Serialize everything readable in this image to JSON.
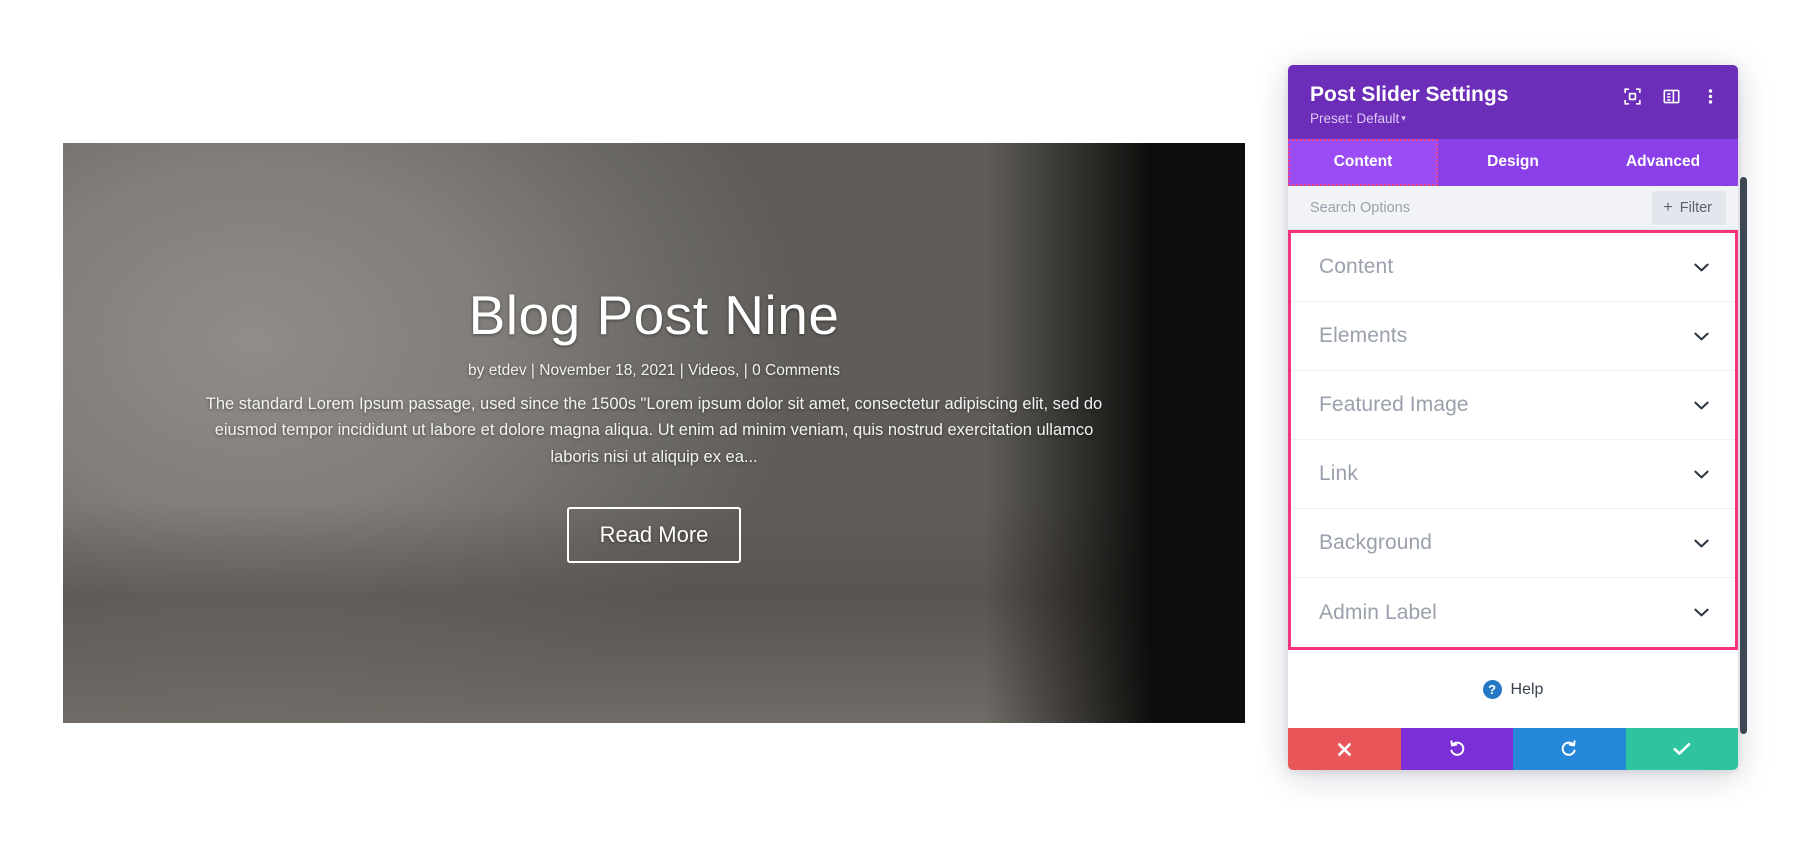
{
  "builder": {
    "slide": {
      "title": "Blog Post Nine",
      "meta": "by etdev  |  November 18, 2021  |  Videos,  |  0 Comments",
      "body": "The standard Lorem Ipsum passage, used since the 1500s \"Lorem ipsum dolor sit amet, consectetur adipiscing elit, sed do eiusmod tempor incididunt ut labore et dolore magna aliqua. Ut enim ad minim veniam, quis nostrud exercitation ullamco laboris nisi ut aliquip ex ea...",
      "read_more_label": "Read More"
    }
  },
  "modal": {
    "title": "Post Slider Settings",
    "preset_label": "Preset: Default",
    "preset_caret": "▾",
    "header_icons": [
      {
        "name": "expand-icon"
      },
      {
        "name": "layout-icon"
      },
      {
        "name": "more-options-icon"
      }
    ],
    "tabs": [
      {
        "label": "Content",
        "active": true
      },
      {
        "label": "Design",
        "active": false
      },
      {
        "label": "Advanced",
        "active": false
      }
    ],
    "search": {
      "value": "",
      "placeholder": "Search Options"
    },
    "filter": {
      "label": "Filter",
      "plus": "+"
    },
    "sections": [
      {
        "label": "Content"
      },
      {
        "label": "Elements"
      },
      {
        "label": "Featured Image"
      },
      {
        "label": "Link"
      },
      {
        "label": "Background"
      },
      {
        "label": "Admin Label"
      }
    ],
    "help": {
      "badge": "?",
      "label": "Help"
    },
    "actions": [
      {
        "name": "cancel-button",
        "color": "#E9565A"
      },
      {
        "name": "undo-button",
        "color": "#7B2FD6"
      },
      {
        "name": "redo-button",
        "color": "#2587D8"
      },
      {
        "name": "save-button",
        "color": "#2EC4A0"
      }
    ]
  },
  "colors": {
    "header_purple": "#6C2EB9",
    "tabbar_purple": "#8B3FE8",
    "active_tab_purple": "#9A4DF5",
    "highlight_pink": "#F5327E",
    "dotted_pink": "#F0407E",
    "cancel_red": "#E9565A",
    "undo_purple": "#7B2FD6",
    "redo_blue": "#2587D8",
    "save_teal": "#2EC4A0",
    "help_blue": "#2579C4"
  }
}
